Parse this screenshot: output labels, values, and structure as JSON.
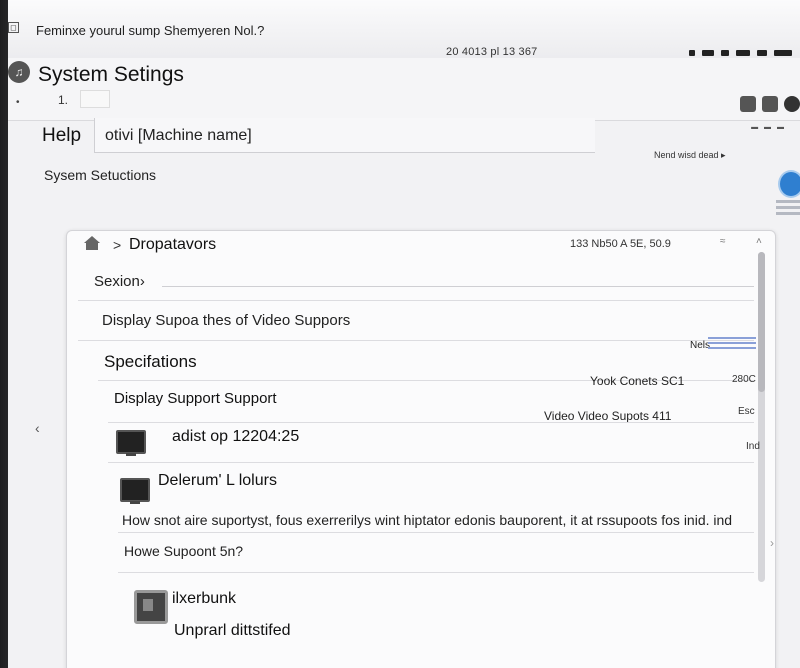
{
  "window": {
    "close_glyph": "◻",
    "title": "Feminxe yourul sump Shemyeren Nol.?",
    "time": "20 4013 pl 13 367"
  },
  "app": {
    "icon_glyph": "♫",
    "title": "System Setings",
    "toolbar_a": "•",
    "toolbar_b": "1.",
    "status_icon_names": [
      "battery-icon",
      "wifi-icon",
      "volume-icon",
      "signal-icon"
    ]
  },
  "help": {
    "label": "Help",
    "machine_value": "otivi [Machine name]",
    "feed_link": "Nend wisd dead ▸",
    "system_sections": "Sysem Setuctions"
  },
  "panel": {
    "breadcrumb_arrow": ">",
    "breadcrumb": "Dropatavors",
    "version": "133 Nb50 A 5E, 50.9",
    "close_glyph": "≈",
    "scroll_up_glyph": "˄",
    "section_label": "Sexion›",
    "display_support": "Display Supoa thes of Video Suppors",
    "specs_title": "Specifations",
    "menu_label": "Nels",
    "ds_support": "Display Support Support",
    "col_label_1": "Yook Conets SC1",
    "col_value_1": "280C",
    "col_label_2": "Video Video Supots 411",
    "col_value_2": "Esc",
    "col_value_3": "Ind",
    "left_chevron": "‹",
    "right_chevron": "›",
    "items": [
      {
        "text": "adist op 12204:25"
      },
      {
        "text": "Delerum' L lolurs"
      }
    ],
    "para_1": "How snot aire suportyst, fous exerrerilys wint hiptator edonis bauporent, it at rssupoots fos inid. ind",
    "para_2": "Howe Supoont 5n?",
    "bottom_item_1": "ilxerbunk",
    "bottom_item_2": "Unprarl dittstifed"
  }
}
